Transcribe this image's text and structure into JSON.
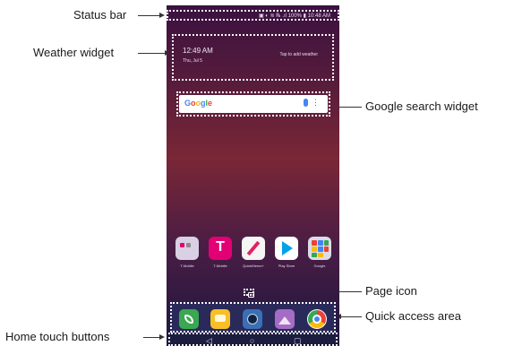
{
  "callouts": {
    "status_bar": "Status bar",
    "weather_widget": "Weather widget",
    "google_search_widget": "Google search widget",
    "page_icon": "Page icon",
    "quick_access_area": "Quick access area",
    "home_touch_buttons": "Home touch buttons"
  },
  "status_bar": {
    "text": "▣ ◐ ≋ ℞ .ıl 100% ▮ 10:48 AM"
  },
  "weather_widget": {
    "time": "12:49 AM",
    "date": "Thu, Jul 5",
    "tap_text": "Tap to add weather"
  },
  "search_widget": {
    "logo": "Google",
    "mic_icon": "mic-icon",
    "menu_icon": "more-vertical-icon"
  },
  "apps": [
    {
      "label": "T-Mobile",
      "icon": "folder-icon",
      "color": "#d9d0e3"
    },
    {
      "label": "T-Mobile",
      "icon": "t-mobile-icon",
      "color": "#e20074"
    },
    {
      "label": "QuickMemo+",
      "icon": "pencil-icon",
      "color": "#f5f5f5"
    },
    {
      "label": "Play Store",
      "icon": "play-store-icon",
      "color": "#ffffff"
    },
    {
      "label": "Google",
      "icon": "google-folder-icon",
      "color": "#dcdce8"
    }
  ],
  "dock": [
    {
      "icon": "phone-icon",
      "color": "#3aa751"
    },
    {
      "icon": "messages-icon",
      "color": "#f6c026"
    },
    {
      "icon": "camera-icon",
      "color": "#3a6fb5"
    },
    {
      "icon": "gallery-icon",
      "color": "#a46cc4"
    },
    {
      "icon": "chrome-icon",
      "color": "#ffffff"
    }
  ],
  "nav": {
    "back": "◁",
    "home": "○",
    "recent": "▢"
  }
}
